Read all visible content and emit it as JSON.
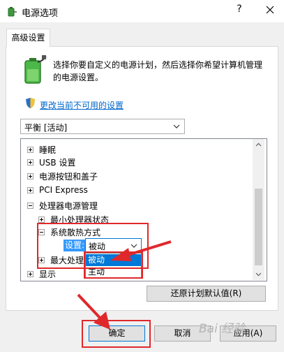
{
  "window": {
    "title": "电源选项",
    "help": "?"
  },
  "tabs": [
    {
      "label": "高级设置"
    }
  ],
  "description": "选择你要自定义的电源计划，然后选择你希望计算机管理的电源设置。",
  "change_settings_link": "更改当前不可用的设置",
  "plan_select": {
    "value": "平衡 [活动]"
  },
  "tree": [
    {
      "label": "睡眠",
      "expanded": false
    },
    {
      "label": "USB 设置",
      "expanded": false
    },
    {
      "label": "电源按钮和盖子",
      "expanded": false
    },
    {
      "label": "PCI Express",
      "expanded": false
    },
    {
      "label": "处理器电源管理",
      "expanded": true
    },
    {
      "label": "最小处理器状态",
      "expanded": false
    },
    {
      "label": "系统散热方式",
      "expanded": true
    },
    {
      "label": "最大处理",
      "expanded": false
    },
    {
      "label": "显示",
      "expanded": false
    }
  ],
  "setting": {
    "label": "设置:",
    "value": "被动",
    "options": [
      "被动",
      "主动"
    ]
  },
  "buttons": {
    "restore_defaults": "还原计划默认值(R)",
    "ok": "确定",
    "cancel": "取消",
    "apply": "应用(A)"
  },
  "watermark": "Bai 经验",
  "annotation_color": "#e0282b",
  "icons": [
    "power-options-icon",
    "battery-plug-icon",
    "uac-shield-icon",
    "close-icon",
    "chevron-down-icon"
  ]
}
